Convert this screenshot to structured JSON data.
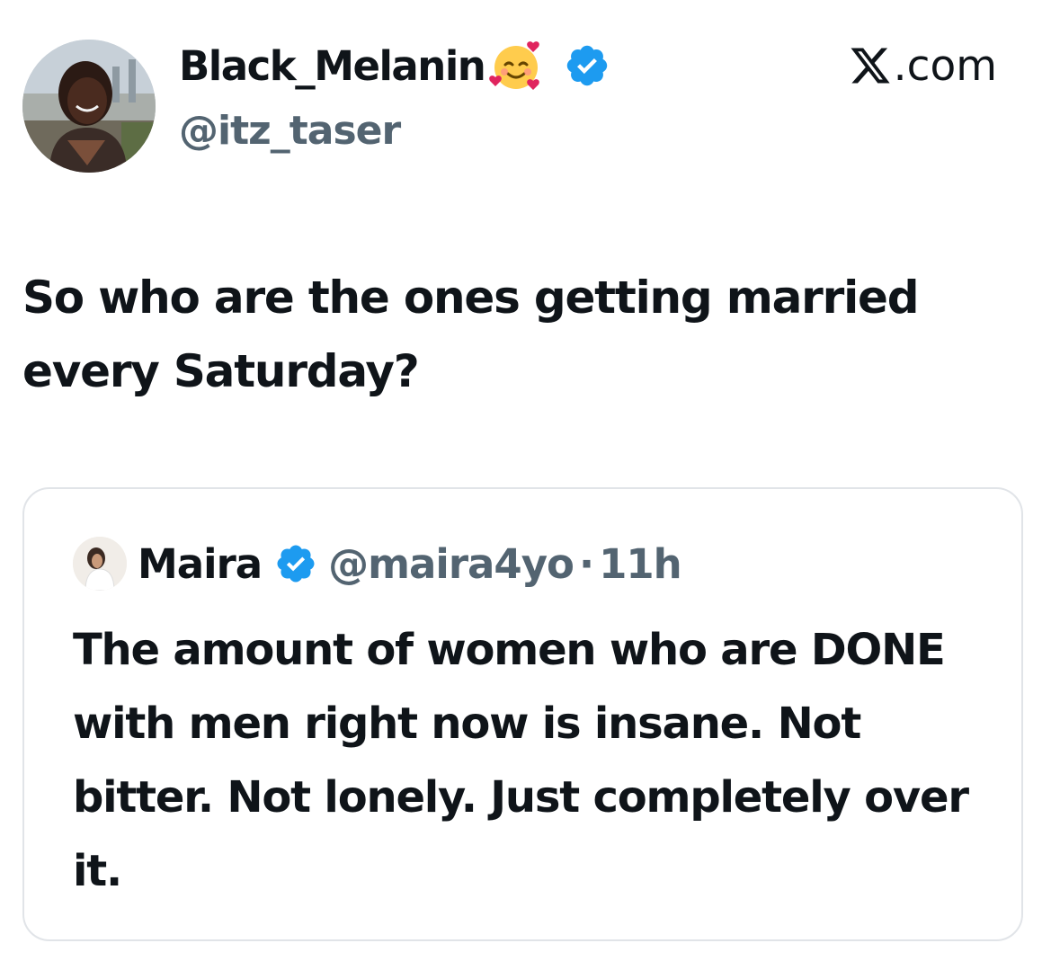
{
  "author": {
    "display_name": "Black_Melanin",
    "name_emoji": "smiling-face-with-hearts-emoji",
    "verified_icon": "verified-badge-icon",
    "handle": "@itz_taser",
    "avatar": "profile-photo"
  },
  "brand": {
    "icon": "x-logo-icon",
    "label": ".com"
  },
  "tweet": {
    "text": "So who are the ones getting married every Saturday?"
  },
  "quote": {
    "avatar": "profile-photo",
    "name": "Maira",
    "verified_icon": "verified-badge-icon",
    "handle": "@maira4yo",
    "separator": "·",
    "time": "11h",
    "text": "The amount of women who are DONE with men right now is insane. Not bitter. Not lonely. Just completely over it."
  },
  "colors": {
    "primary_text": "#0f1419",
    "secondary_text": "#536471",
    "verified_blue": "#1d9bf0",
    "card_border": "#e1e4e8"
  }
}
